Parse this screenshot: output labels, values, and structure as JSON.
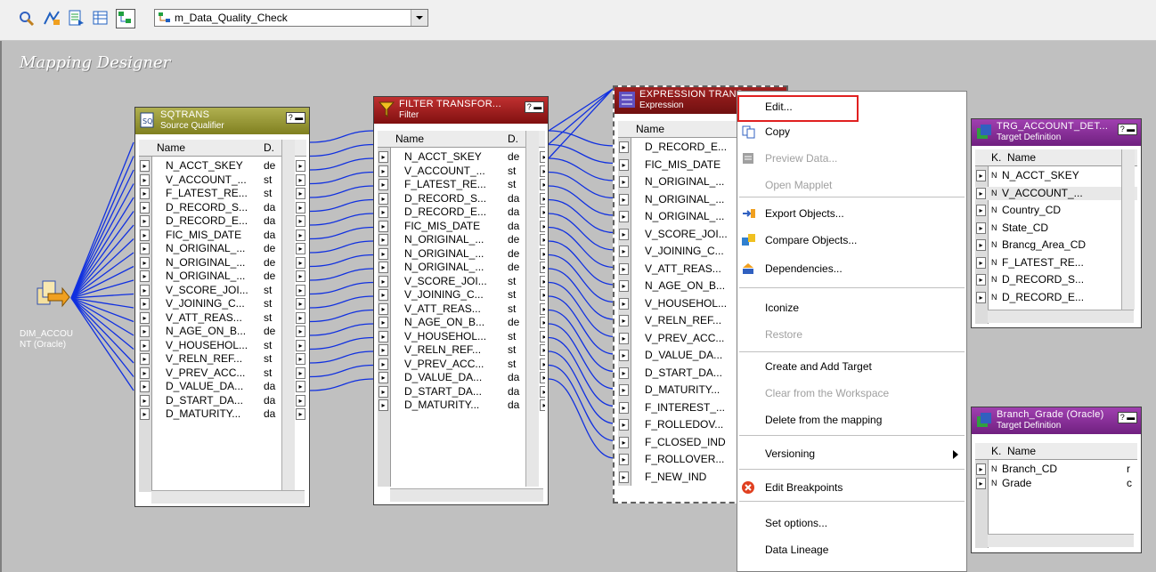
{
  "toolbar": {
    "icons": [
      "find-icon",
      "layout-icon",
      "document-icon",
      "table-icon",
      "arrange-icon"
    ],
    "mapping_name": "m_Data_Quality_Check"
  },
  "canvas": {
    "title": "Mapping Designer"
  },
  "source": {
    "label_line1": "DIM_ACCOU",
    "label_line2": "NT (Oracle)"
  },
  "sqtrans": {
    "title": "SQTRANS",
    "subtitle": "Source Qualifier",
    "col_name": "Name",
    "col_type": "D.",
    "rows": [
      {
        "name": "N_ACCT_SKEY",
        "type": "de"
      },
      {
        "name": "V_ACCOUNT_...",
        "type": "st"
      },
      {
        "name": "F_LATEST_RE...",
        "type": "st"
      },
      {
        "name": "D_RECORD_S...",
        "type": "da"
      },
      {
        "name": "D_RECORD_E...",
        "type": "da"
      },
      {
        "name": "FIC_MIS_DATE",
        "type": "da"
      },
      {
        "name": "N_ORIGINAL_...",
        "type": "de"
      },
      {
        "name": "N_ORIGINAL_...",
        "type": "de"
      },
      {
        "name": "N_ORIGINAL_...",
        "type": "de"
      },
      {
        "name": "V_SCORE_JOI...",
        "type": "st"
      },
      {
        "name": "V_JOINING_C...",
        "type": "st"
      },
      {
        "name": "V_ATT_REAS...",
        "type": "st"
      },
      {
        "name": "N_AGE_ON_B...",
        "type": "de"
      },
      {
        "name": "V_HOUSEHOL...",
        "type": "st"
      },
      {
        "name": "V_RELN_REF...",
        "type": "st"
      },
      {
        "name": "V_PREV_ACC...",
        "type": "st"
      },
      {
        "name": "D_VALUE_DA...",
        "type": "da"
      },
      {
        "name": "D_START_DA...",
        "type": "da"
      },
      {
        "name": "D_MATURITY...",
        "type": "da"
      }
    ]
  },
  "filter": {
    "title": "FILTER TRANSFOR...",
    "subtitle": "Filter",
    "col_name": "Name",
    "col_type": "D.",
    "rows": [
      {
        "name": "N_ACCT_SKEY",
        "type": "de"
      },
      {
        "name": "V_ACCOUNT_...",
        "type": "st"
      },
      {
        "name": "F_LATEST_RE...",
        "type": "st"
      },
      {
        "name": "D_RECORD_S...",
        "type": "da"
      },
      {
        "name": "D_RECORD_E...",
        "type": "da"
      },
      {
        "name": "FIC_MIS_DATE",
        "type": "da"
      },
      {
        "name": "N_ORIGINAL_...",
        "type": "de"
      },
      {
        "name": "N_ORIGINAL_...",
        "type": "de"
      },
      {
        "name": "N_ORIGINAL_...",
        "type": "de"
      },
      {
        "name": "V_SCORE_JOI...",
        "type": "st"
      },
      {
        "name": "V_JOINING_C...",
        "type": "st"
      },
      {
        "name": "V_ATT_REAS...",
        "type": "st"
      },
      {
        "name": "N_AGE_ON_B...",
        "type": "de"
      },
      {
        "name": "V_HOUSEHOL...",
        "type": "st"
      },
      {
        "name": "V_RELN_REF...",
        "type": "st"
      },
      {
        "name": "V_PREV_ACC...",
        "type": "st"
      },
      {
        "name": "D_VALUE_DA...",
        "type": "da"
      },
      {
        "name": "D_START_DA...",
        "type": "da"
      },
      {
        "name": "D_MATURITY...",
        "type": "da"
      }
    ]
  },
  "expression": {
    "title": "EXPRESSION TRANS...",
    "subtitle": "Expression",
    "col_name": "Name",
    "rows": [
      "D_RECORD_E...",
      "FIC_MIS_DATE",
      "N_ORIGINAL_...",
      "N_ORIGINAL_...",
      "N_ORIGINAL_...",
      "V_SCORE_JOI...",
      "V_JOINING_C...",
      "V_ATT_REAS...",
      "N_AGE_ON_B...",
      "V_HOUSEHOL...",
      "V_RELN_REF...",
      "V_PREV_ACC...",
      "D_VALUE_DA...",
      "D_START_DA...",
      "D_MATURITY...",
      "F_INTEREST_...",
      "F_ROLLEDOV...",
      "F_CLOSED_IND",
      "F_ROLLOVER...",
      "F_NEW_IND"
    ]
  },
  "context_menu": {
    "items": [
      {
        "label": "Edit...",
        "enabled": true,
        "icon": ""
      },
      {
        "label": "Copy",
        "enabled": true,
        "icon": "copy-icon"
      },
      {
        "label": "Preview Data...",
        "enabled": false,
        "icon": "preview-icon"
      },
      {
        "label": "Open Mapplet",
        "enabled": false,
        "icon": ""
      },
      {
        "label": "Export Objects...",
        "enabled": true,
        "icon": "export-icon"
      },
      {
        "label": "Compare Objects...",
        "enabled": true,
        "icon": "compare-icon"
      },
      {
        "label": "Dependencies...",
        "enabled": true,
        "icon": "dependencies-icon"
      },
      {
        "label": "Iconize",
        "enabled": true,
        "icon": ""
      },
      {
        "label": "Restore",
        "enabled": false,
        "icon": ""
      },
      {
        "label": "Create and Add Target",
        "enabled": true,
        "icon": ""
      },
      {
        "label": "Clear from the Workspace",
        "enabled": false,
        "icon": ""
      },
      {
        "label": "Delete from the mapping",
        "enabled": true,
        "icon": ""
      },
      {
        "label": "Versioning",
        "enabled": true,
        "icon": "submenu-arrow-icon"
      },
      {
        "label": "Edit Breakpoints",
        "enabled": true,
        "icon": "breakpoint-icon"
      },
      {
        "label": "Set options...",
        "enabled": true,
        "icon": ""
      },
      {
        "label": "Data Lineage",
        "enabled": true,
        "icon": ""
      }
    ]
  },
  "target_account": {
    "title": "TRG_ACCOUNT_DET...",
    "subtitle": "Target Definition",
    "col_key": "K.",
    "col_name": "Name",
    "rows": [
      "N_ACCT_SKEY",
      "V_ACCOUNT_...",
      "Country_CD",
      "State_CD",
      "Brancg_Area_CD",
      "F_LATEST_RE...",
      "D_RECORD_S...",
      "D_RECORD_E..."
    ]
  },
  "target_branch": {
    "title": "Branch_Grade (Oracle)",
    "subtitle": "Target Definition",
    "col_key": "K.",
    "col_name": "Name",
    "rows": [
      {
        "name": "Branch_CD",
        "type": "r"
      },
      {
        "name": "Grade",
        "type": "c"
      }
    ]
  }
}
